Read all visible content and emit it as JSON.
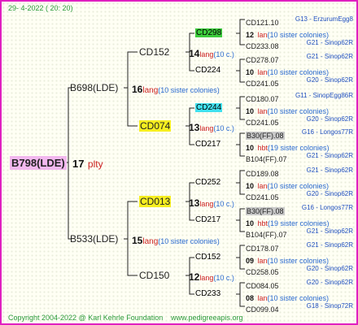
{
  "header": {
    "date": "29-  4-2022  ( 20: 20)"
  },
  "footer": {
    "copyright": "Copyright 2004-2022 @ Karl Kehrle Foundation",
    "site": "www.pedigreeapis.org"
  },
  "root": {
    "id": "B798(LDE)",
    "num": "17",
    "rel": "plty"
  },
  "gen1": [
    {
      "id": "B698(LDE)",
      "num": "16",
      "rel": "lang",
      "extra": "(10 sister colonies)"
    },
    {
      "id": "B533(LDE)",
      "num": "15",
      "rel": "lang",
      "extra": "(10 sister colonies)"
    }
  ],
  "gen2": [
    {
      "id": "CD152",
      "num": "14",
      "rel": "lang",
      "extra": "(10 c.)"
    },
    {
      "id": "CD074",
      "num": "13",
      "rel": "lang",
      "extra": "(10 c.)"
    },
    {
      "id": "CD013",
      "num": "13",
      "rel": "lang",
      "extra": "(10 c.)"
    },
    {
      "id": "CD150",
      "num": "12",
      "rel": "lang",
      "extra": "(10 c.)"
    }
  ],
  "gen3": [
    {
      "id": "CD298"
    },
    {
      "id": "CD224"
    },
    {
      "id": "CD244"
    },
    {
      "id": "CD217"
    },
    {
      "id": "CD252"
    },
    {
      "id": "CD217"
    },
    {
      "id": "CD152"
    },
    {
      "id": "CD233"
    }
  ],
  "gen4": [
    {
      "top": "CD121.10",
      "topsrc": "G13 - ErzurumEgg8",
      "num": "12",
      "rel": "lan",
      "extra": "(10 sister colonies)",
      "bot": "CD233.08",
      "botsrc": "G21 - Sinop62R"
    },
    {
      "top": "CD278.07",
      "topsrc": "G21 - Sinop62R",
      "num": "10",
      "rel": "lan",
      "extra": "(10 sister colonies)",
      "bot": "CD241.05",
      "botsrc": "G20 - Sinop62R"
    },
    {
      "top": "CD180.07",
      "topsrc": "G11 - SinopEgg86R",
      "num": "10",
      "rel": "lan",
      "extra": "(10 sister colonies)",
      "bot": "CD241.05",
      "botsrc": "G20 - Sinop62R"
    },
    {
      "top": "B30(FF).08",
      "topsrc": "G16 - Longos77R",
      "num": "10",
      "rel": "hbt",
      "extra": "(19 sister colonies)",
      "bot": "B104(FF).07",
      "botsrc": "G21 - Sinop62R"
    },
    {
      "top": "CD189.08",
      "topsrc": "G21 - Sinop62R",
      "num": "10",
      "rel": "lan",
      "extra": "(10 sister colonies)",
      "bot": "CD241.05",
      "botsrc": "G20 - Sinop62R"
    },
    {
      "top": "B30(FF).08",
      "topsrc": "G16 - Longos77R",
      "num": "10",
      "rel": "hbt",
      "extra": "(19 sister colonies)",
      "bot": "B104(FF).07",
      "botsrc": "G21 - Sinop62R"
    },
    {
      "top": "CD178.07",
      "topsrc": "G21 - Sinop62R",
      "num": "09",
      "rel": "lan",
      "extra": "(10 sister colonies)",
      "bot": "CD258.05",
      "botsrc": "G20 - Sinop62R"
    },
    {
      "top": "CD084.05",
      "topsrc": "G20 - Sinop62R",
      "num": "08",
      "rel": "lan",
      "extra": "(10 sister colonies)",
      "bot": "CD099.04",
      "botsrc": "G18 - Sinop72R"
    }
  ]
}
